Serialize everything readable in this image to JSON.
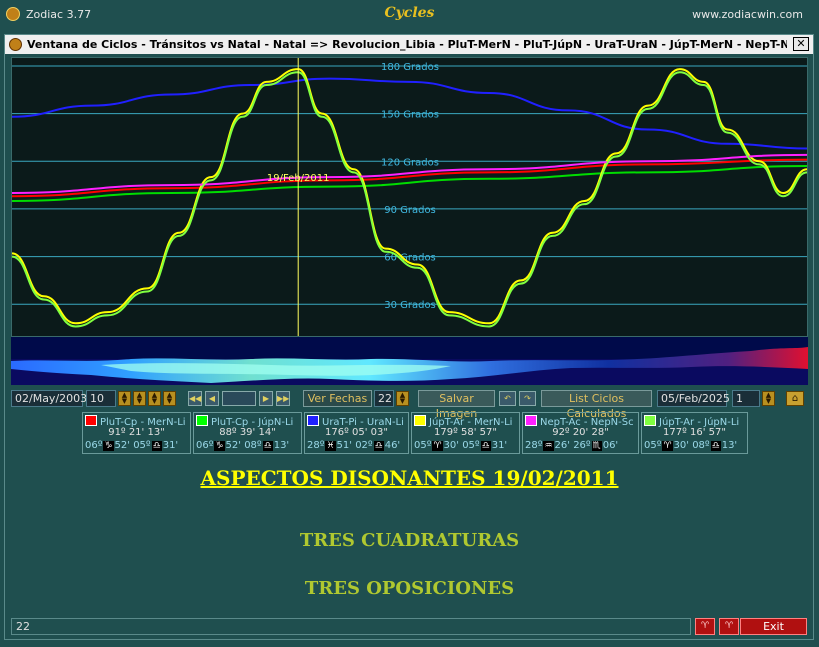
{
  "app": {
    "name": "Zodiac 3.77",
    "title": "Cycles",
    "website": "www.zodiacwin.com"
  },
  "window": {
    "title": "Ventana de Ciclos - Tránsitos vs Natal - Natal => Revolucion_Libia - PluT-MerN - PluT-JúpN - UraT-UraN - JúpT-MerN - NepT-NepN - Júp...",
    "close_label": "✕"
  },
  "chart_data": {
    "type": "line",
    "ylim": [
      10,
      185
    ],
    "grid_labels": [
      "180 Grados",
      "150 Grados",
      "120 Grados",
      "90 Grados",
      "60 Grados",
      "30 Grados"
    ],
    "grid_values": [
      180,
      150,
      120,
      90,
      60,
      30
    ],
    "marker": {
      "label": "19/Feb/2011",
      "position": 0.36
    },
    "x_range": [
      "02/May/2003",
      "05/Feb/2025"
    ],
    "series": [
      {
        "name": "PluT-Cp - MerN-Li",
        "color": "#ff0000",
        "x": [
          0,
          0.2,
          0.4,
          0.6,
          0.8,
          1.0
        ],
        "y": [
          98,
          103,
          108,
          113,
          118,
          121
        ]
      },
      {
        "name": "PluT-Cp - JúpN-Li",
        "color": "#00dd00",
        "x": [
          0,
          0.2,
          0.4,
          0.6,
          0.8,
          1.0
        ],
        "y": [
          95,
          100,
          104,
          109,
          113,
          117
        ]
      },
      {
        "name": "UraT-Pi - UraN-Li",
        "color": "#2020ff",
        "x": [
          0,
          0.1,
          0.2,
          0.3,
          0.4,
          0.5,
          0.6,
          0.7,
          0.8,
          0.9,
          1.0
        ],
        "y": [
          148,
          155,
          162,
          168,
          172,
          170,
          163,
          152,
          140,
          131,
          128
        ]
      },
      {
        "name": "JúpT-Ar - MerN-Li",
        "color": "#ffff00",
        "x": [
          0,
          0.04,
          0.08,
          0.12,
          0.17,
          0.21,
          0.25,
          0.29,
          0.32,
          0.36,
          0.39,
          0.43,
          0.47,
          0.51,
          0.55,
          0.6,
          0.64,
          0.68,
          0.72,
          0.76,
          0.8,
          0.84,
          0.87,
          0.9,
          0.94,
          0.97,
          1.0
        ],
        "y": [
          62,
          35,
          18,
          25,
          40,
          75,
          110,
          150,
          170,
          178,
          150,
          115,
          65,
          55,
          25,
          18,
          45,
          75,
          95,
          125,
          155,
          178,
          170,
          140,
          120,
          100,
          115
        ]
      },
      {
        "name": "NepT-Ac - NepN-Sc",
        "color": "#ff20ff",
        "x": [
          0,
          0.2,
          0.4,
          0.6,
          0.8,
          1.0
        ],
        "y": [
          100,
          105,
          110,
          115,
          120,
          124
        ]
      },
      {
        "name": "JúpT-Ar - JúpN-Li",
        "color": "#80ff40",
        "x": [
          0,
          0.04,
          0.08,
          0.12,
          0.17,
          0.21,
          0.25,
          0.29,
          0.32,
          0.36,
          0.39,
          0.43,
          0.47,
          0.51,
          0.55,
          0.6,
          0.64,
          0.68,
          0.72,
          0.76,
          0.8,
          0.84,
          0.87,
          0.9,
          0.94,
          0.97,
          1.0
        ],
        "y": [
          60,
          33,
          16,
          23,
          38,
          73,
          108,
          148,
          168,
          176,
          148,
          113,
          63,
          53,
          23,
          16,
          43,
          73,
          93,
          123,
          153,
          176,
          168,
          138,
          118,
          98,
          113
        ]
      }
    ]
  },
  "controls": {
    "start_date": "02/May/2003",
    "step_value": "10",
    "ver_fechas_label": "Ver Fechas",
    "ver_fechas_value": "22",
    "save_image_label": "Salvar Imagen",
    "list_cycles_label": "List Ciclos Calculados",
    "end_date": "05/Feb/2025",
    "end_value": "1"
  },
  "legend": [
    {
      "color": "#ff0000",
      "title": "PluT-Cp - MerN-Li",
      "angle": "91º 21' 13\"",
      "left": "06º",
      "g1": "♑",
      "mid1": "52'",
      "m2": "05º",
      "g2": "♎",
      "right": "31'"
    },
    {
      "color": "#00ff00",
      "title": "PluT-Cp - JúpN-Li",
      "angle": "88º 39' 14\"",
      "left": "06º",
      "g1": "♑",
      "mid1": "52'",
      "m2": "08º",
      "g2": "♎",
      "right": "13'"
    },
    {
      "color": "#2020ff",
      "title": "UraT-Pi - UraN-Li",
      "angle": "176º 05' 03\"",
      "left": "28º",
      "g1": "♓",
      "mid1": "51'",
      "m2": "02º",
      "g2": "♎",
      "right": "46'"
    },
    {
      "color": "#ffff00",
      "title": "JúpT-Ar - MerN-Li",
      "angle": "179º 58' 57\"",
      "left": "05º",
      "g1": "♈",
      "mid1": "30'",
      "m2": "05º",
      "g2": "♎",
      "right": "31'"
    },
    {
      "color": "#ff20ff",
      "title": "NepT-Ac - NepN-Sc",
      "angle": "92º 20' 28\"",
      "left": "28º",
      "g1": "♒",
      "mid1": "26'",
      "m2": "26º",
      "g2": "♏",
      "right": "06'"
    },
    {
      "color": "#80ff40",
      "title": "JúpT-Ar - JúpN-Li",
      "angle": "177º 16' 57\"",
      "left": "05º",
      "g1": "♈",
      "mid1": "30'",
      "m2": "08º",
      "g2": "♎",
      "right": "13'"
    }
  ],
  "content": {
    "heading": "ASPECTOS DISONANTES 19/02/2011",
    "line1": "TRES CUADRATURAS",
    "line2": "TRES OPOSICIONES"
  },
  "status": {
    "value": "22",
    "btn1": "♈",
    "btn2": "♈",
    "exit_label": "Exit"
  }
}
